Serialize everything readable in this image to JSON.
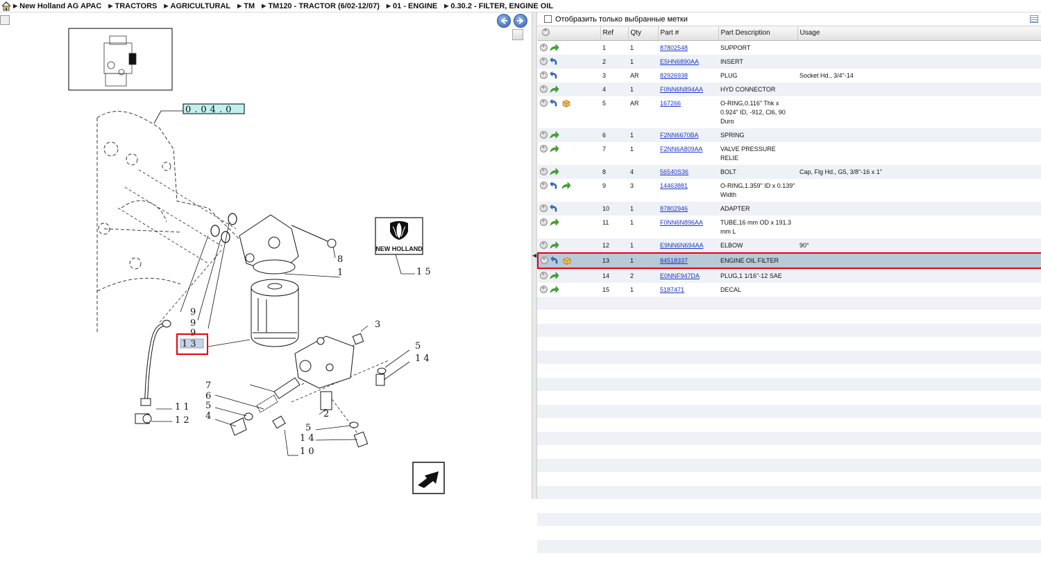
{
  "breadcrumb": [
    "New Holland AG APAC",
    "TRACTORS",
    "AGRICULTURAL",
    "TM",
    "TM120 - TRACTOR (6/02-12/07)",
    "01 - ENGINE",
    "0.30.2 - FILTER, ENGINE OIL"
  ],
  "drawing": {
    "section_code": "0.04.0",
    "selected_callout": "13",
    "brand_logo": "NEW HOLLAND"
  },
  "filter": {
    "label": "Отобразить только выбранные метки",
    "checked": false
  },
  "table": {
    "columns": [
      "Ref",
      "Qty",
      "Part #",
      "Part Description",
      "Usage"
    ],
    "rows": [
      {
        "ref": "1",
        "qty": "1",
        "part": "87802548",
        "desc": "SUPPORT",
        "usage": "",
        "icons": [
          "green-arrow"
        ]
      },
      {
        "ref": "2",
        "qty": "1",
        "part": "E5HN6890AA",
        "desc": "INSERT",
        "usage": "",
        "icons": [
          "blue-arrow"
        ]
      },
      {
        "ref": "3",
        "qty": "AR",
        "part": "82926938",
        "desc": "PLUG",
        "usage": "Socket Hd., 3/4\"-14",
        "icons": [
          "blue-arrow"
        ]
      },
      {
        "ref": "4",
        "qty": "1",
        "part": "F0NN6N894AA",
        "desc": "HYD CONNECTOR",
        "usage": "",
        "icons": [
          "green-arrow"
        ]
      },
      {
        "ref": "5",
        "qty": "AR",
        "part": "167266",
        "desc": "O-RING,0.116\" Thk x 0.924\" ID, -912, Cl6, 90 Duro",
        "usage": "",
        "icons": [
          "blue-arrow",
          "kit-box"
        ]
      },
      {
        "ref": "6",
        "qty": "1",
        "part": "F2NN6670BA",
        "desc": "SPRING",
        "usage": "",
        "icons": [
          "green-arrow"
        ]
      },
      {
        "ref": "7",
        "qty": "1",
        "part": "F2NN6A809AA",
        "desc": "VALVE PRESSURE RELIE",
        "usage": "",
        "icons": [
          "green-arrow"
        ]
      },
      {
        "ref": "8",
        "qty": "4",
        "part": "56540S36",
        "desc": "BOLT",
        "usage": "Cap, Flg Hd., G5, 3/8\"-16 x 1\"",
        "icons": [
          "green-arrow"
        ]
      },
      {
        "ref": "9",
        "qty": "3",
        "part": "14463881",
        "desc": "O-RING,1.359\" ID x 0.139\" Width",
        "usage": "",
        "icons": [
          "blue-arrow",
          "green-arrow"
        ]
      },
      {
        "ref": "10",
        "qty": "1",
        "part": "87802946",
        "desc": "ADAPTER",
        "usage": "",
        "icons": [
          "blue-arrow"
        ]
      },
      {
        "ref": "11",
        "qty": "1",
        "part": "F0NN6N896AA",
        "desc": "TUBE,16 mm OD x 191.3 mm L",
        "usage": "",
        "icons": [
          "green-arrow"
        ]
      },
      {
        "ref": "12",
        "qty": "1",
        "part": "E9NN6N694AA",
        "desc": "ELBOW",
        "usage": "90°",
        "icons": [
          "green-arrow"
        ]
      },
      {
        "ref": "13",
        "qty": "1",
        "part": "84518337",
        "desc": "ENGINE OIL FILTER",
        "usage": "",
        "icons": [
          "blue-arrow",
          "kit-box"
        ],
        "selected": true
      },
      {
        "ref": "14",
        "qty": "2",
        "part": "E0NNF947DA",
        "desc": "PLUG,1 1/16\"-12 SAE",
        "usage": "",
        "icons": [
          "green-arrow"
        ]
      },
      {
        "ref": "15",
        "qty": "1",
        "part": "5187471",
        "desc": "DECAL",
        "usage": "",
        "icons": [
          "green-arrow"
        ]
      }
    ]
  },
  "colors": {
    "selection_outline": "#e2000f",
    "link": "#1a35c8",
    "row_alt": "#eef2f7",
    "row_selected": "#b9c9d8"
  }
}
